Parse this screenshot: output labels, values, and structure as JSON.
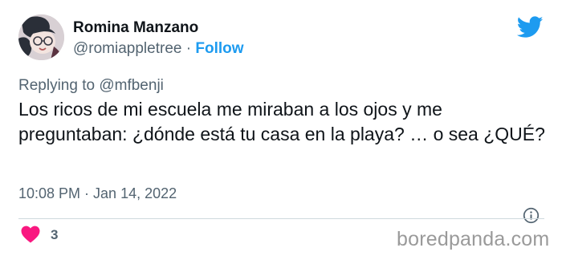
{
  "author": {
    "display_name": "Romina Manzano",
    "handle": "@romiappletree",
    "separator": "·",
    "follow_label": "Follow"
  },
  "reply": {
    "prefix": "Replying to",
    "handle": "@mfbenji"
  },
  "tweet": {
    "text": "Los ricos de mi escuela me miraban a los ojos y me preguntaban: ¿dónde está tu casa en la playa? … o sea ¿QUÉ?",
    "timestamp": "10:08 PM · Jan 14, 2022"
  },
  "engagement": {
    "like_count": "3"
  },
  "watermark": {
    "text": "boredpanda.com"
  },
  "icons": {
    "logo": "twitter-bird-icon",
    "info": "info-icon",
    "like": "heart-icon"
  },
  "colors": {
    "accent": "#1d9bf0",
    "heart": "#f91880",
    "secondary_text": "#536471",
    "primary_text": "#0f1419",
    "watermark": "#9a9a9a"
  }
}
